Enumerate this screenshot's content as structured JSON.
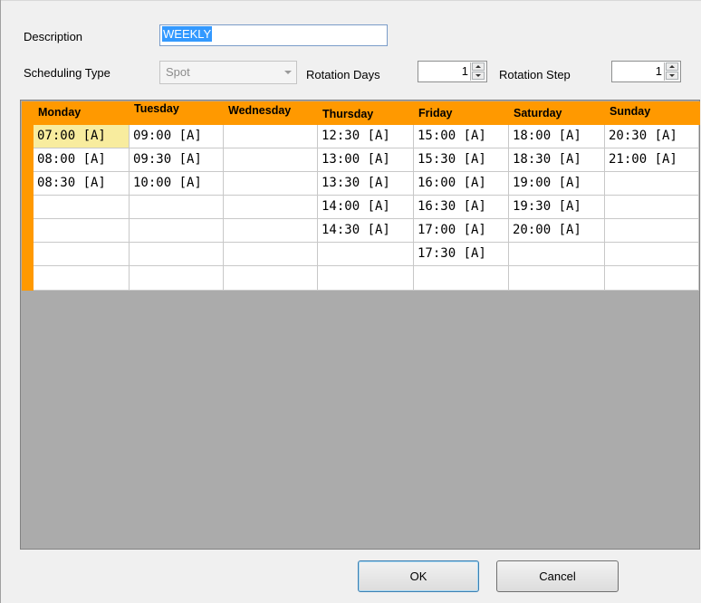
{
  "form": {
    "description_label": "Description",
    "description_value": "WEEKLY",
    "scheduling_type_label": "Scheduling Type",
    "scheduling_type_value": "Spot",
    "rotation_days_label": "Rotation Days",
    "rotation_days_value": "1",
    "rotation_step_label": "Rotation Step",
    "rotation_step_value": "1"
  },
  "grid": {
    "header_color": "#ff9900",
    "active_cell_color": "#f8ec9e",
    "columns": [
      "Monday",
      "Tuesday",
      "Wednesday",
      "Thursday",
      "Friday",
      "Saturday",
      "Sunday"
    ],
    "rows": [
      [
        "07:00 [A]",
        "09:00 [A]",
        "",
        "12:30 [A]",
        "15:00 [A]",
        "18:00 [A]",
        "20:30 [A]"
      ],
      [
        "08:00 [A]",
        "09:30 [A]",
        "",
        "13:00 [A]",
        "15:30 [A]",
        "18:30 [A]",
        "21:00 [A]"
      ],
      [
        "08:30 [A]",
        "10:00 [A]",
        "",
        "13:30 [A]",
        "16:00 [A]",
        "19:00 [A]",
        ""
      ],
      [
        "",
        "",
        "",
        "14:00 [A]",
        "16:30 [A]",
        "19:30 [A]",
        ""
      ],
      [
        "",
        "",
        "",
        "14:30 [A]",
        "17:00 [A]",
        "20:00 [A]",
        ""
      ],
      [
        "",
        "",
        "",
        "",
        "17:30 [A]",
        "",
        ""
      ],
      [
        "",
        "",
        "",
        "",
        "",
        "",
        ""
      ]
    ]
  },
  "buttons": {
    "ok_label": "OK",
    "cancel_label": "Cancel"
  }
}
